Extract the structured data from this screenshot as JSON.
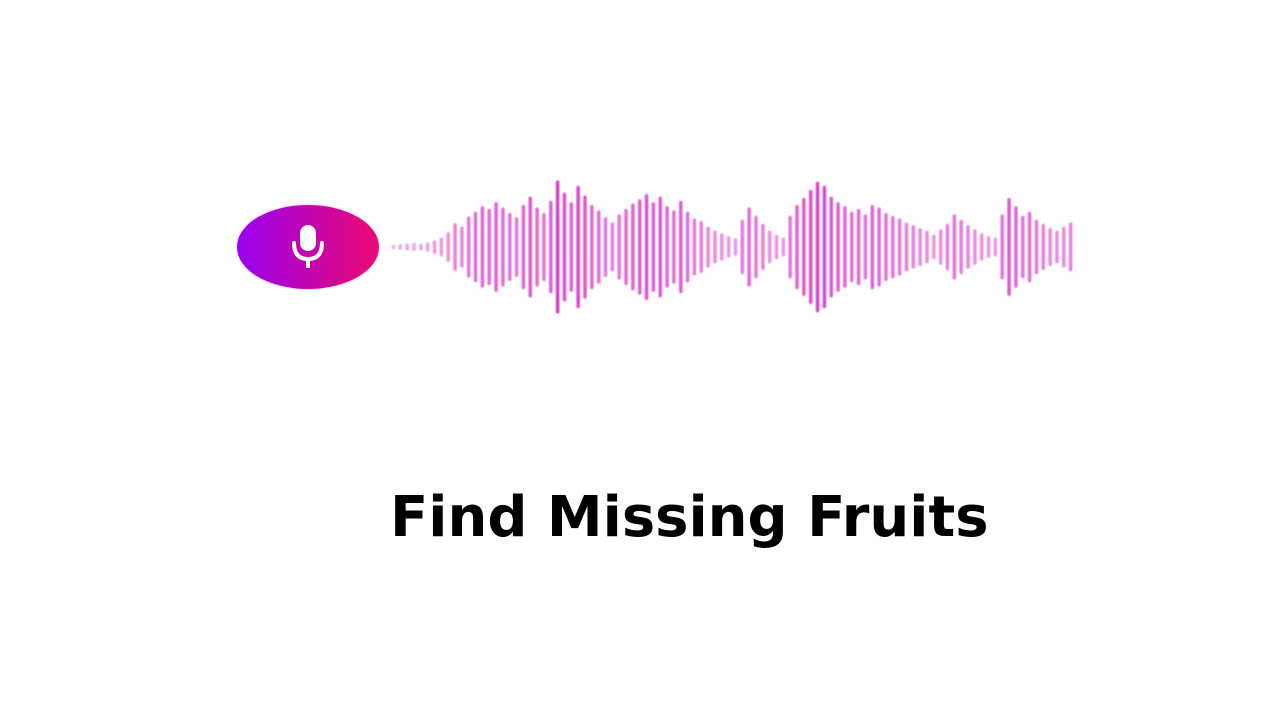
{
  "title": "Find Missing Fruits",
  "mic_button": {
    "icon": "microphone-icon",
    "gradient_start": "#9a00f0",
    "gradient_end": "#ea0a73"
  },
  "waveform": {
    "gradient_start": "#b04cf2",
    "gradient_mid": "#d43bd6",
    "gradient_end": "#ff1c6a",
    "levels": [
      0.03,
      0.04,
      0.05,
      0.06,
      0.05,
      0.07,
      0.1,
      0.14,
      0.22,
      0.35,
      0.3,
      0.45,
      0.52,
      0.6,
      0.56,
      0.66,
      0.58,
      0.5,
      0.44,
      0.62,
      0.74,
      0.58,
      0.5,
      0.68,
      0.98,
      0.8,
      0.66,
      0.9,
      0.76,
      0.62,
      0.54,
      0.44,
      0.36,
      0.48,
      0.56,
      0.64,
      0.7,
      0.78,
      0.66,
      0.74,
      0.6,
      0.54,
      0.68,
      0.52,
      0.42,
      0.38,
      0.3,
      0.24,
      0.2,
      0.16,
      0.13,
      0.4,
      0.58,
      0.46,
      0.34,
      0.24,
      0.18,
      0.14,
      0.46,
      0.62,
      0.72,
      0.84,
      0.96,
      0.9,
      0.74,
      0.66,
      0.6,
      0.52,
      0.56,
      0.48,
      0.62,
      0.58,
      0.5,
      0.46,
      0.42,
      0.36,
      0.32,
      0.28,
      0.24,
      0.18,
      0.26,
      0.34,
      0.48,
      0.4,
      0.32,
      0.26,
      0.2,
      0.16,
      0.14,
      0.48,
      0.72,
      0.6,
      0.46,
      0.52,
      0.4,
      0.34,
      0.28,
      0.24,
      0.3,
      0.36
    ]
  }
}
